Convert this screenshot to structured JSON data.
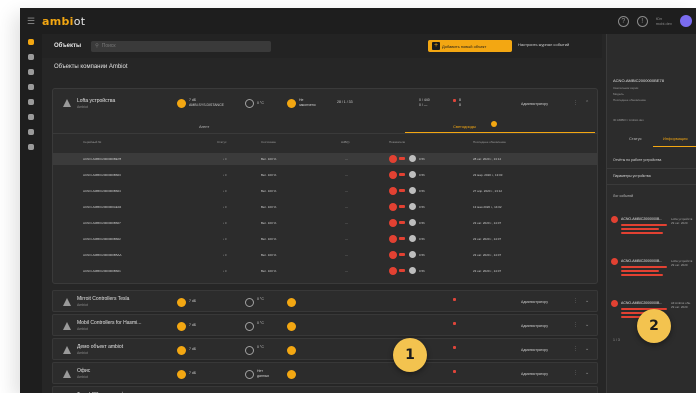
{
  "app": {
    "logo_prefix": "ambi",
    "logo_suffix": "ot",
    "user_sub": "Юл\nmobi.dev"
  },
  "header": {
    "title": "Объекты",
    "search_placeholder": "Поиск",
    "add_button": "Добавить новый объект",
    "settings_link": "Настроить журнал событий"
  },
  "company_title": "Объекты компании Ambiot",
  "card": {
    "device_name": "Lofta устройства",
    "device_sub": "Ambiot",
    "stat1": "7 dБ\nAMBI.SYS.DISTANCE",
    "stat2": "0 °C",
    "stat3": "Не\nзакончено",
    "stat4": "28 / 1 / 33",
    "stat5": "0 / 440\n0 / —",
    "stat6": "8\n8",
    "link": "Администратору",
    "tabs": [
      "Агент",
      "Светодиоды"
    ],
    "columns": [
      "Серийный №",
      "Статус",
      "Состояние",
      "ΔdB(t)",
      "Показатели",
      "Последнее обновление"
    ],
    "rows": [
      {
        "serial": "ACNO-AMBIC2000000BE78",
        "state": "Вкл. 100 %",
        "value": "0.5h",
        "time": "28 окт. 2020 г., 13:12",
        "selected": true
      },
      {
        "serial": "ACNO-AMBIC2000000B603",
        "state": "Вкл. 100 %",
        "value": "0.5h",
        "time": "23 мар. 2020 г., 13:03",
        "selected": false
      },
      {
        "serial": "ACNO-AMBIC2000000B604",
        "state": "Вкл. 100 %",
        "value": "0.5h",
        "time": "27 апр. 2020 г., 13:12",
        "selected": false
      },
      {
        "serial": "ACNO-AMBIC2000000AE04",
        "state": "Вкл. 100 %",
        "value": "0.5h",
        "time": "13 мая 2020 г., 14:02",
        "selected": false
      },
      {
        "serial": "ACNO-AMBIC2000000B607",
        "state": "Вкл. 100 %",
        "value": "0.5h",
        "time": "23 окт. 2020 г., 14:07",
        "selected": false
      },
      {
        "serial": "ACNO-AMBIC2000000B602",
        "state": "Вкл. 100 %",
        "value": "0.5h",
        "time": "23 окт. 2020 г., 14:07",
        "selected": false
      },
      {
        "serial": "ACNO-AMBIC2000000B5AA",
        "state": "Вкл. 100 %",
        "value": "0.5h",
        "time": "23 окт. 2020 г., 14:07",
        "selected": false
      },
      {
        "serial": "ACNO-AMBIC2000000B601",
        "state": "Вкл. 100 %",
        "value": "0.5h",
        "time": "23 окт. 2020 г., 14:07",
        "selected": false
      }
    ]
  },
  "list_rows": [
    {
      "name": "Mirroit Controllers Tesla",
      "sub": "Ambiot",
      "stat": "7 dБ",
      "stat2": "0 °C",
      "link": "Администратору"
    },
    {
      "name": "Mobil Controllers for Hasmi...",
      "sub": "Ambiot",
      "stat": "7 dБ",
      "stat2": "0 °C",
      "link": "Администратору"
    },
    {
      "name": "Демо объект ambiot",
      "sub": "Ambiot",
      "stat": "7 dБ",
      "stat2": "0 °C",
      "link": "Администратору"
    },
    {
      "name": "Офис",
      "sub": "Ambiot",
      "stat": "7 dБ",
      "stat2": "Нет\nданных",
      "link": "Администратору"
    },
    {
      "name": "Тест LCD клиент офис",
      "sub": "Ambiot",
      "stat": "7 dБ",
      "stat2": "0 °C",
      "link": "Администратору"
    }
  ],
  "panel": {
    "device_id": "ACNO-AMBIC2000000BE78",
    "sub_lines": [
      "Светильник серии",
      "Модель",
      "Последнее обновление"
    ],
    "meta": "ID:AMBIO / Ambiot.dev",
    "tabs": [
      "Статус",
      "Информация"
    ],
    "rows": [
      "Отчёты по работе устройства",
      "Параметры устройства"
    ],
    "events_title": "Лог событий",
    "events": [
      {
        "id": "ACNO-AMBIC2000000B...",
        "right": "Lofta устройств\n29 окт. 2020"
      },
      {
        "id": "ACNO-AMBIC2000000B...",
        "right": "Lofta устройств\n29 окт. 2020"
      },
      {
        "id": "ACNO-AMBIC2000000B...",
        "right": "All Ambiot обн.\n29 окт. 2020"
      }
    ],
    "pager": "1 / 3"
  },
  "markers": [
    "1",
    "2"
  ],
  "colors": {
    "accent": "#f3a712",
    "danger": "#e24132",
    "bg": "#262626"
  }
}
